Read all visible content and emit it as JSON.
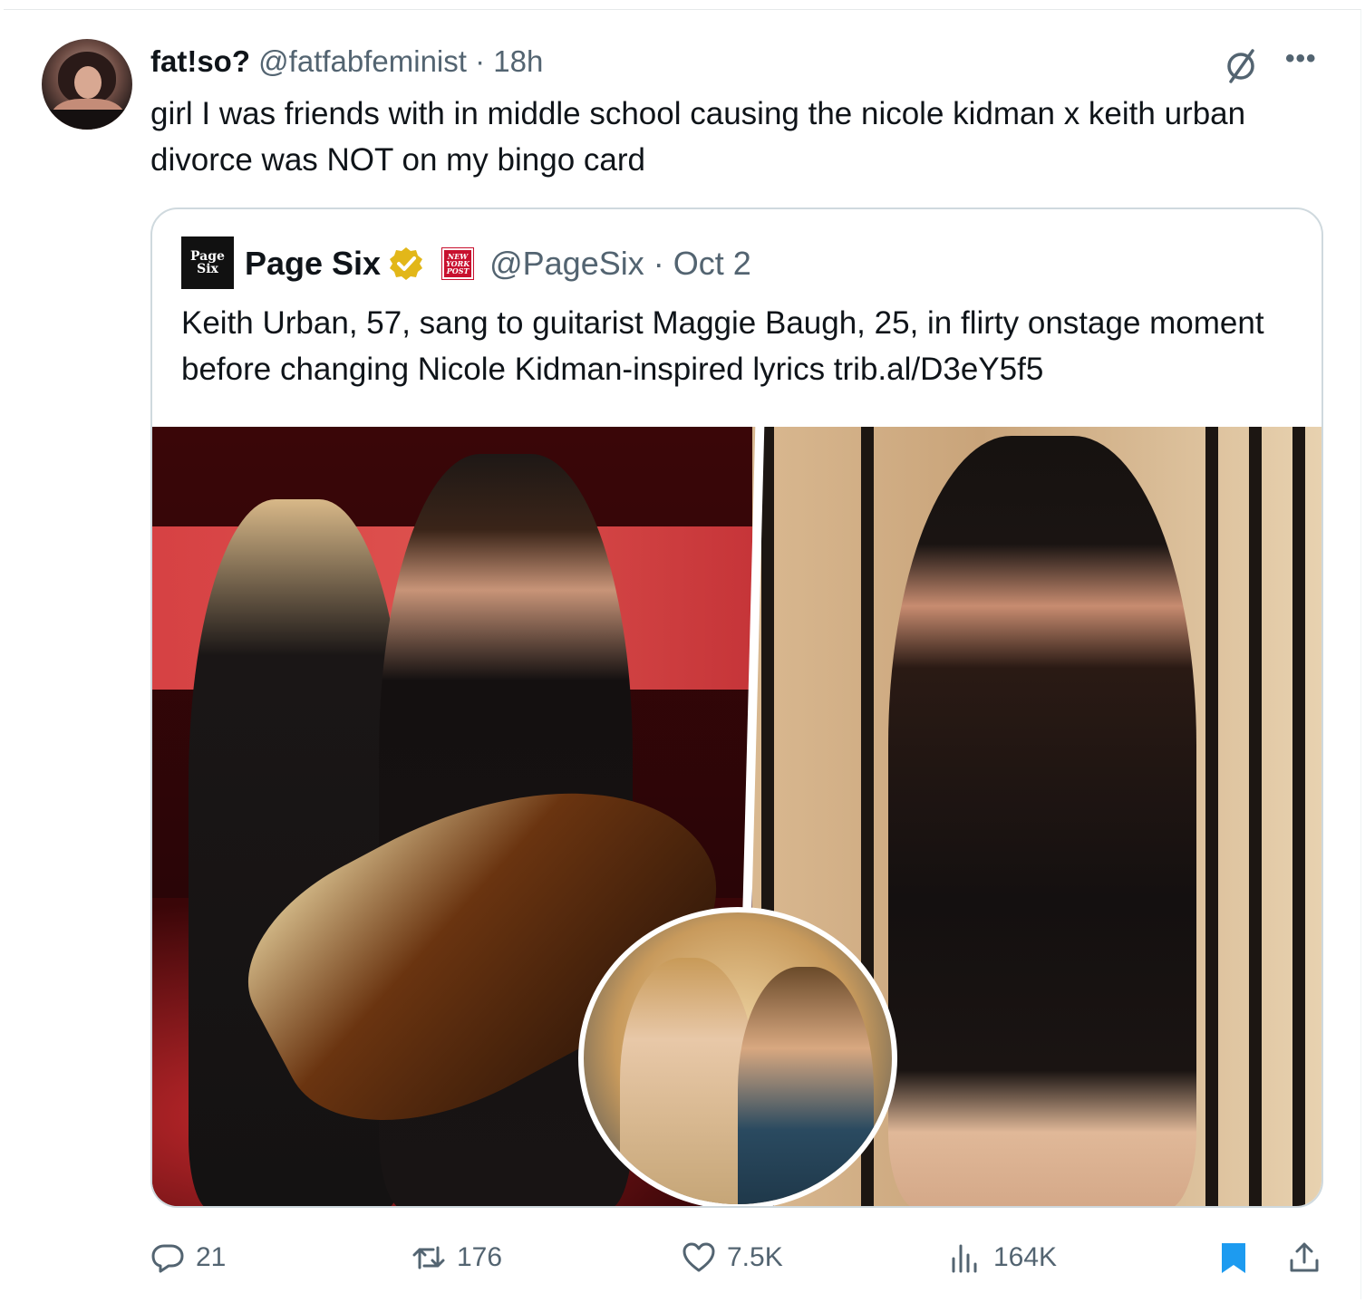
{
  "tweet": {
    "author_name": "fat!so?",
    "author_handle": "@fatfabfeminist",
    "separator": "·",
    "time": "18h",
    "text": "girl I was friends with in middle school causing the nicole kidman x keith urban divorce was NOT on my bingo card",
    "more_icon": "more-horizontal-icon",
    "grok_icon": "grok-icon"
  },
  "quote": {
    "avatar_text_top": "Page",
    "avatar_text_bottom": "Six",
    "name": "Page Six",
    "affiliate_text": [
      "NEW",
      "YORK",
      "POST"
    ],
    "handle_time": "@PageSix · Oct 2",
    "text": "Keith Urban, 57, sang to guitarist Maggie Baugh, 25, in flirty onstage moment before changing Nicole Kidman-inspired lyrics trib.al/D3eY5f5"
  },
  "actions": {
    "replies": "21",
    "reposts": "176",
    "likes": "7.5K",
    "views": "164K"
  },
  "colors": {
    "accent": "#1d9bf0",
    "muted": "#536471",
    "verified_gold": "#e2b719"
  }
}
